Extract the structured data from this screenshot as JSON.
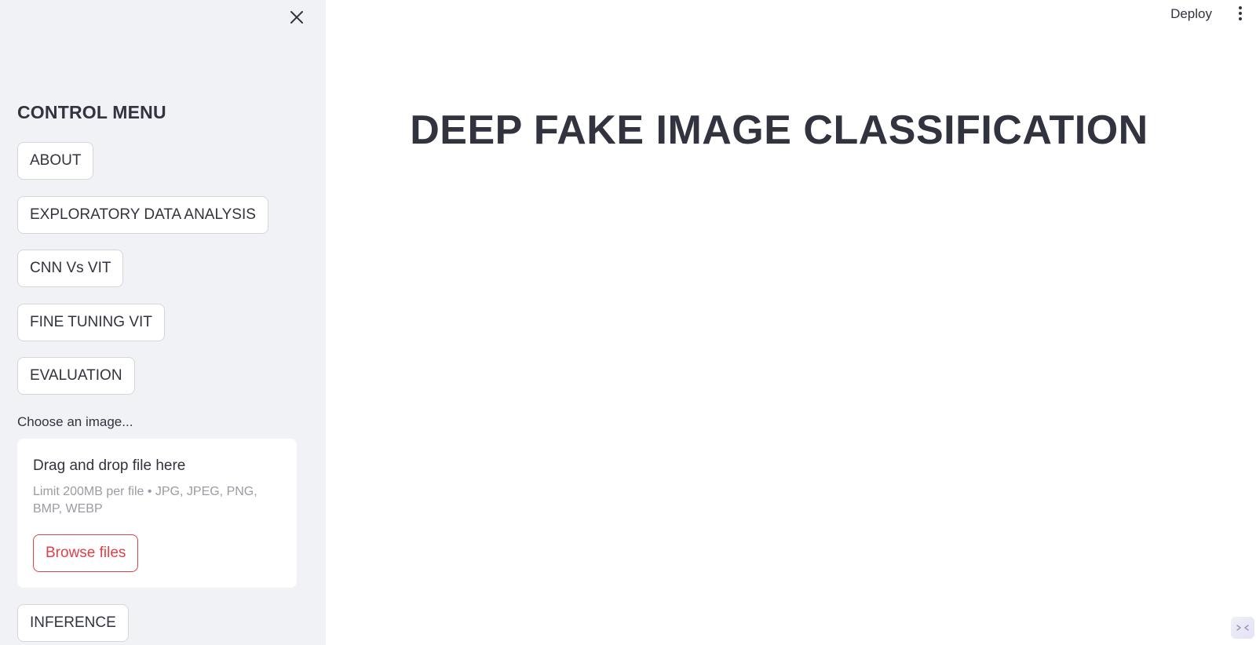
{
  "sidebar": {
    "heading": "CONTROL MENU",
    "buttons": {
      "about": "ABOUT",
      "eda": "EXPLORATORY DATA ANALYSIS",
      "cnn_vs_vit": "CNN Vs VIT",
      "fine_tuning": "FINE TUNING VIT",
      "evaluation": "EVALUATION",
      "inference": "INFERENCE"
    },
    "uploader": {
      "label": "Choose an image...",
      "drop_title": "Drag and drop file here",
      "limit_text": "Limit 200MB per file • JPG, JPEG, PNG, BMP, WEBP",
      "browse_label": "Browse files"
    }
  },
  "header": {
    "deploy_label": "Deploy"
  },
  "main": {
    "title": "DEEP FAKE IMAGE CLASSIFICATION"
  },
  "colors": {
    "sidebar_bg": "#f0f2f6",
    "text": "#31333f",
    "accent": "#e0404a"
  },
  "icons": {
    "close": "close-icon",
    "menu": "kebab-menu-icon",
    "badge": "streamlit-badge-icon"
  }
}
